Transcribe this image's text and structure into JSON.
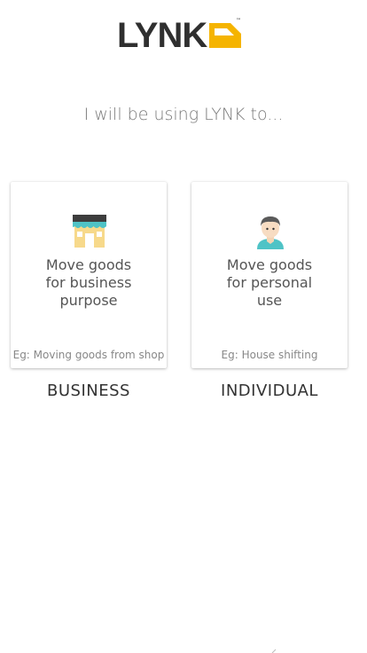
{
  "app": {
    "logo_text": "LYNK",
    "logo_tm": "™",
    "brand_color": "#f5b400"
  },
  "tagline": "I will be using LYNK to...",
  "options": [
    {
      "id": "business",
      "icon": "shop-icon",
      "description": "Move goods\nfor business\npurpose",
      "example": "Eg: Moving goods from shop",
      "label": "BUSINESS"
    },
    {
      "id": "individual",
      "icon": "person-icon",
      "description": "Move goods\nfor personal\nuse",
      "example": "Eg: House shifting",
      "label": "INDIVIDUAL"
    }
  ]
}
